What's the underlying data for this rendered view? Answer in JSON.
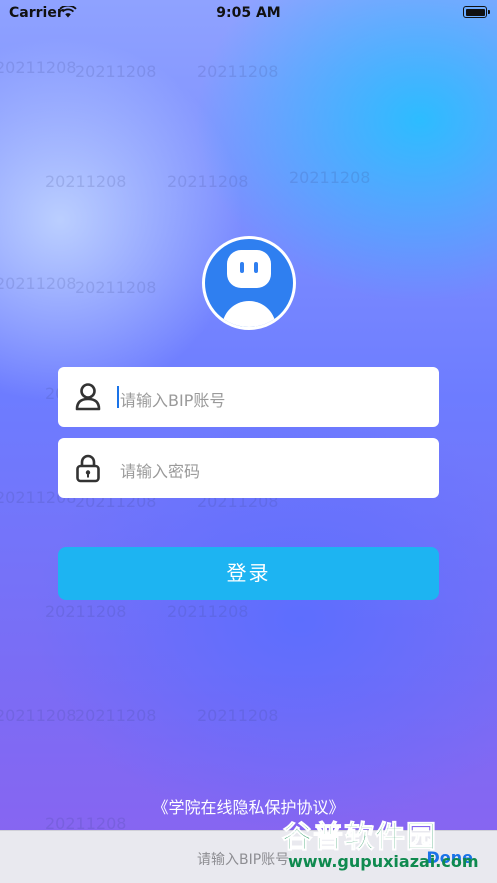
{
  "status_bar": {
    "carrier": "Carrier",
    "time": "9:05 AM"
  },
  "watermark_text": "20211208",
  "login_form": {
    "account_placeholder": "请输入BIP账号",
    "password_placeholder": "请输入密码",
    "login_label": "登录",
    "privacy_link": "《学院在线隐私保护协议》"
  },
  "keyboard_bar": {
    "text": "请输入BIP账号",
    "done_label": "Done"
  },
  "overlay_logo": {
    "name": "谷普软件园",
    "url": "www.gupuxiazai.com"
  },
  "colors": {
    "accent": "#1db4f2",
    "avatar": "#2f7ff0"
  }
}
